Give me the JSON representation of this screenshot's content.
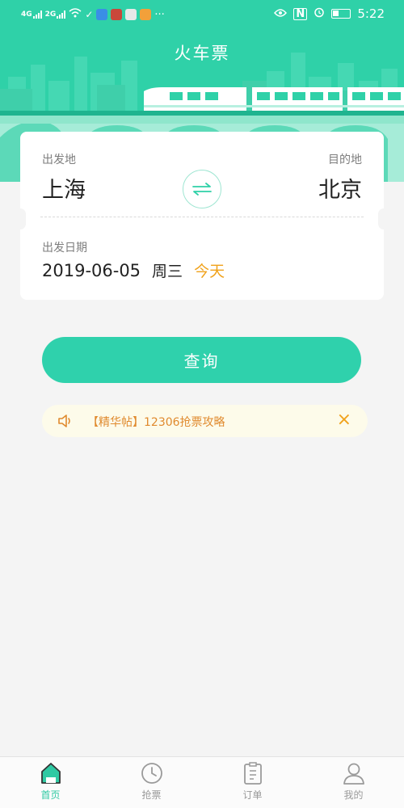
{
  "status_bar": {
    "time": "5:22",
    "signal_1": "4G",
    "signal_2": "2G",
    "more": "···"
  },
  "header": {
    "title": "火车票"
  },
  "route": {
    "from_label": "出发地",
    "from_city": "上海",
    "to_label": "目的地",
    "to_city": "北京",
    "swap_icon": "swap-arrows-icon"
  },
  "date": {
    "label": "出发日期",
    "value": "2019-06-05",
    "weekday": "周三",
    "today": "今天"
  },
  "search": {
    "label": "查询"
  },
  "notice": {
    "text": "【精华帖】12306抢票攻略",
    "close": "×"
  },
  "tabs": [
    {
      "label": "首页",
      "icon": "home-icon",
      "active": true
    },
    {
      "label": "抢票",
      "icon": "clock-icon",
      "active": false
    },
    {
      "label": "订单",
      "icon": "order-list-icon",
      "active": false
    },
    {
      "label": "我的",
      "icon": "user-icon",
      "active": false
    }
  ],
  "colors": {
    "accent": "#2fd1a8",
    "highlight": "#f0a21b",
    "notice_bg": "#fdfbea"
  }
}
